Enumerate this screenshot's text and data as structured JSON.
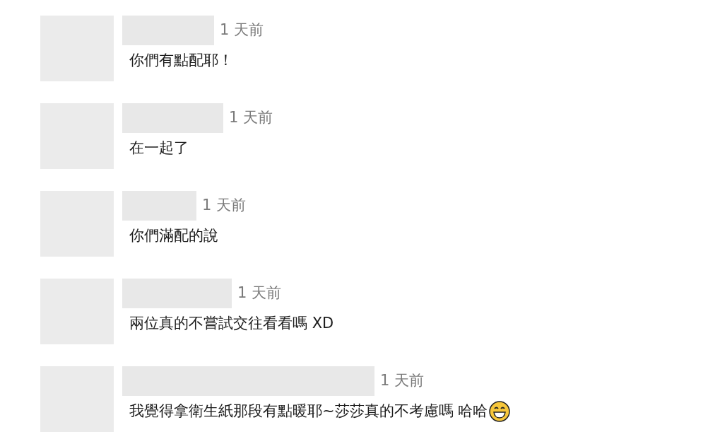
{
  "comments": [
    {
      "time": "1 天前",
      "text": "你們有點配耶！",
      "emoji": false
    },
    {
      "time": "1 天前",
      "text": "在一起了",
      "emoji": false
    },
    {
      "time": "1 天前",
      "text": "你們滿配的說",
      "emoji": false
    },
    {
      "time": "1 天前",
      "text": "兩位真的不嘗試交往看看嗎 XD",
      "emoji": false
    },
    {
      "time": "1 天前",
      "text": "我覺得拿衛生紙那段有點暖耶~莎莎真的不考慮嗎 哈哈",
      "emoji": true
    }
  ]
}
